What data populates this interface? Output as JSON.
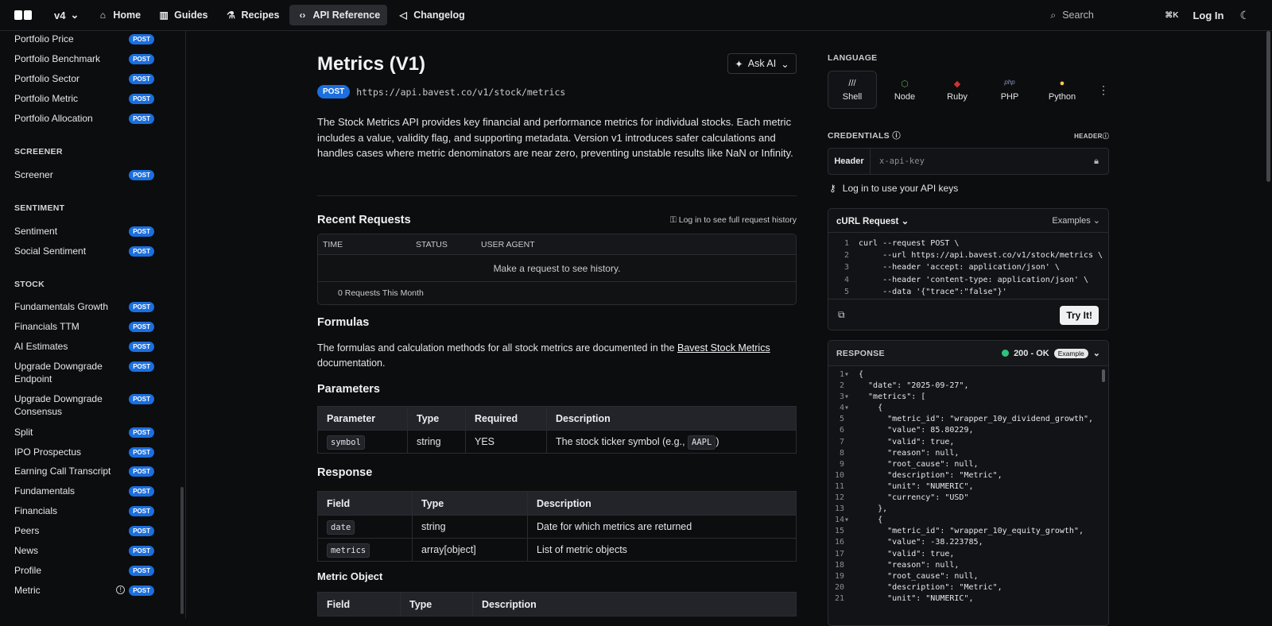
{
  "topbar": {
    "version": "v4",
    "nav": [
      {
        "label": "Home",
        "icon": "home-icon"
      },
      {
        "label": "Guides",
        "icon": "book-icon"
      },
      {
        "label": "Recipes",
        "icon": "flask-icon"
      },
      {
        "label": "API Reference",
        "icon": "code-icon"
      },
      {
        "label": "Changelog",
        "icon": "megaphone-icon"
      }
    ],
    "search": "Search",
    "shortcut": "⌘K",
    "login": "Log In"
  },
  "sidebar": {
    "items_a": [
      "Portfolio Price",
      "Portfolio Benchmark",
      "Portfolio Sector",
      "Portfolio Metric",
      "Portfolio Allocation"
    ],
    "section_screener": "SCREENER",
    "items_screener": [
      "Screener"
    ],
    "section_sentiment": "SENTIMENT",
    "items_sentiment": [
      "Sentiment",
      "Social Sentiment"
    ],
    "section_stock": "STOCK",
    "items_stock": [
      "Fundamentals Growth",
      "Financials TTM",
      "AI Estimates",
      "Upgrade Downgrade Endpoint",
      "Upgrade Downgrade Consensus",
      "Split",
      "IPO Prospectus",
      "Earning Call Transcript",
      "Fundamentals",
      "Financials",
      "Peers",
      "News",
      "Profile",
      "Metric"
    ],
    "badge": "POST"
  },
  "main": {
    "title": "Metrics (V1)",
    "ask_ai": "Ask AI",
    "method": "POST",
    "url": "https://api.bavest.co/v1/stock/metrics",
    "description": "The Stock Metrics API provides key financial and performance metrics for individual stocks. Each metric includes a value, validity flag, and supporting metadata. Version v1 introduces safer calculations and handles cases where metric denominators are near zero, preventing unstable results like NaN or Infinity.",
    "recent_requests": "Recent Requests",
    "login_history": "Log in to see full request history",
    "req_cols": [
      "TIME",
      "STATUS",
      "USER AGENT"
    ],
    "req_empty": "Make a request to see history.",
    "req_count": "0 Requests This Month",
    "formulas_title": "Formulas",
    "formulas_text_a": "The formulas and calculation methods for all stock metrics are documented in the ",
    "formulas_link": "Bavest Stock Metrics",
    "formulas_text_b": " documentation.",
    "parameters_title": "Parameters",
    "param_cols": [
      "Parameter",
      "Type",
      "Required",
      "Description"
    ],
    "param_row": {
      "name": "symbol",
      "type": "string",
      "required": "YES",
      "desc_a": "The stock ticker symbol (e.g., ",
      "desc_code": "AAPL",
      "desc_b": ")"
    },
    "response_title": "Response",
    "resp_cols": [
      "Field",
      "Type",
      "Description"
    ],
    "resp_rows": [
      {
        "field": "date",
        "type": "string",
        "desc": "Date for which metrics are returned"
      },
      {
        "field": "metrics",
        "type": "array[object]",
        "desc": "List of metric objects"
      }
    ],
    "metric_object_title": "Metric Object",
    "metric_cols": [
      "Field",
      "Type",
      "Description"
    ]
  },
  "right": {
    "language_label": "LANGUAGE",
    "languages": [
      {
        "name": "Shell",
        "icon": "///",
        "color": "#e6e7e9"
      },
      {
        "name": "Node",
        "icon": "⬡",
        "color": "#5fa04e"
      },
      {
        "name": "Ruby",
        "icon": "◆",
        "color": "#cc342d"
      },
      {
        "name": "PHP",
        "icon": "php",
        "color": "#8892bf"
      },
      {
        "name": "Python",
        "icon": "●",
        "color": "#f2c94c"
      }
    ],
    "credentials_label": "CREDENTIALS",
    "header_label": "HEADER",
    "cred_field_label": "Header",
    "cred_placeholder": "x-api-key",
    "login_keys": "Log in to use your API keys",
    "curl_title": "cURL Request",
    "examples": "Examples",
    "curl_lines": [
      "curl --request POST \\",
      "     --url https://api.bavest.co/v1/stock/metrics \\",
      "     --header 'accept: application/json' \\",
      "     --header 'content-type: application/json' \\",
      "     --data '{\"trace\":\"false\"}'"
    ],
    "try_it": "Try It!",
    "response_label": "RESPONSE",
    "status_text": "200 - OK",
    "example_pill": "Example",
    "response_lines": [
      "{",
      "  \"date\": \"2025-09-27\",",
      "  \"metrics\": [",
      "    {",
      "      \"metric_id\": \"wrapper_10y_dividend_growth\",",
      "      \"value\": 85.80229,",
      "      \"valid\": true,",
      "      \"reason\": null,",
      "      \"root_cause\": null,",
      "      \"description\": \"Metric\",",
      "      \"unit\": \"NUMERIC\",",
      "      \"currency\": \"USD\"",
      "    },",
      "    {",
      "      \"metric_id\": \"wrapper_10y_equity_growth\",",
      "      \"value\": -38.223785,",
      "      \"valid\": true,",
      "      \"reason\": null,",
      "      \"root_cause\": null,",
      "      \"description\": \"Metric\",",
      "      \"unit\": \"NUMERIC\","
    ]
  }
}
